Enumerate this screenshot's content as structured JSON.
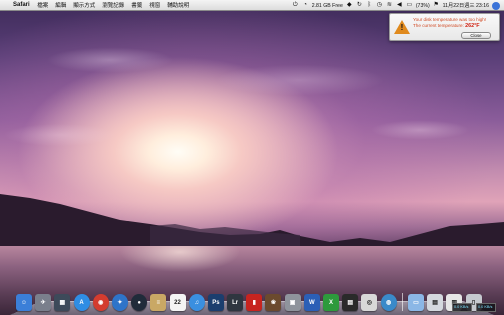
{
  "menubar": {
    "apple": "",
    "app_name": "Safari",
    "items": [
      "檔案",
      "編輯",
      "顯示方式",
      "瀏覽記錄",
      "書籤",
      "視窗",
      "輔助說明"
    ],
    "memory_free": "2.81 GB Free",
    "battery": "(73%)",
    "datetime": "11月22日週三 23:16"
  },
  "notification": {
    "line1": "Your disk temperature was too high!",
    "line2_prefix": "The current temperature:",
    "temperature": "262°F",
    "close_label": "Close"
  },
  "dock": {
    "icons": [
      {
        "name": "finder-icon",
        "glyph": "☺",
        "color": "#3b7fd8"
      },
      {
        "name": "launchpad-icon",
        "glyph": "✈",
        "color": "#7a7f8c"
      },
      {
        "name": "mission-control-icon",
        "glyph": "▦",
        "color": "#3d4a5a"
      },
      {
        "name": "app-store-icon",
        "glyph": "A",
        "color": "#2f8de4"
      },
      {
        "name": "chrome-icon",
        "glyph": "◉",
        "color": "#d43c2f"
      },
      {
        "name": "safari-icon",
        "glyph": "✦",
        "color": "#2e74c9"
      },
      {
        "name": "webcam-icon",
        "glyph": "●",
        "color": "#202b3a"
      },
      {
        "name": "notes-icon",
        "glyph": "≡",
        "color": "#c9a865"
      },
      {
        "name": "calendar-icon",
        "glyph": "22",
        "color": "#f4f4f4"
      },
      {
        "name": "itunes-icon",
        "glyph": "♫",
        "color": "#3a8fe0"
      },
      {
        "name": "photoshop-icon",
        "glyph": "Ps",
        "color": "#1b3e6e"
      },
      {
        "name": "lightroom-icon",
        "glyph": "Lr",
        "color": "#2f3640"
      },
      {
        "name": "photo-booth-icon",
        "glyph": "▮",
        "color": "#c7241f"
      },
      {
        "name": "photo-app-icon",
        "glyph": "❀",
        "color": "#6b4a2e"
      },
      {
        "name": "preview-icon",
        "glyph": "▣",
        "color": "#8f949c"
      },
      {
        "name": "word-icon",
        "glyph": "W",
        "color": "#2b5fb6"
      },
      {
        "name": "excel-icon",
        "glyph": "X",
        "color": "#2d9a3c"
      },
      {
        "name": "vm-icon",
        "glyph": "▤",
        "color": "#2a2a2a"
      },
      {
        "name": "dashboard-icon",
        "glyph": "◎",
        "color": "#d8d8d8"
      },
      {
        "name": "network-icon",
        "glyph": "◍",
        "color": "#3a8ac9"
      }
    ],
    "right_icons": [
      {
        "name": "folder-icon",
        "glyph": "▭",
        "color": "#8bb7e6"
      },
      {
        "name": "downloads-icon",
        "glyph": "▤",
        "color": "#d4d8de"
      },
      {
        "name": "documents-icon",
        "glyph": "▥",
        "color": "#e6e6e6"
      },
      {
        "name": "trash-icon",
        "glyph": "▯",
        "color": "#c5c9cf"
      }
    ],
    "net_meter_1": "0.0 KB/s ↑\n0.0 KB/s ↓",
    "net_meter_1_text": "0.0 KB/s",
    "net_meter_2_text": "0.0 KB/s"
  }
}
